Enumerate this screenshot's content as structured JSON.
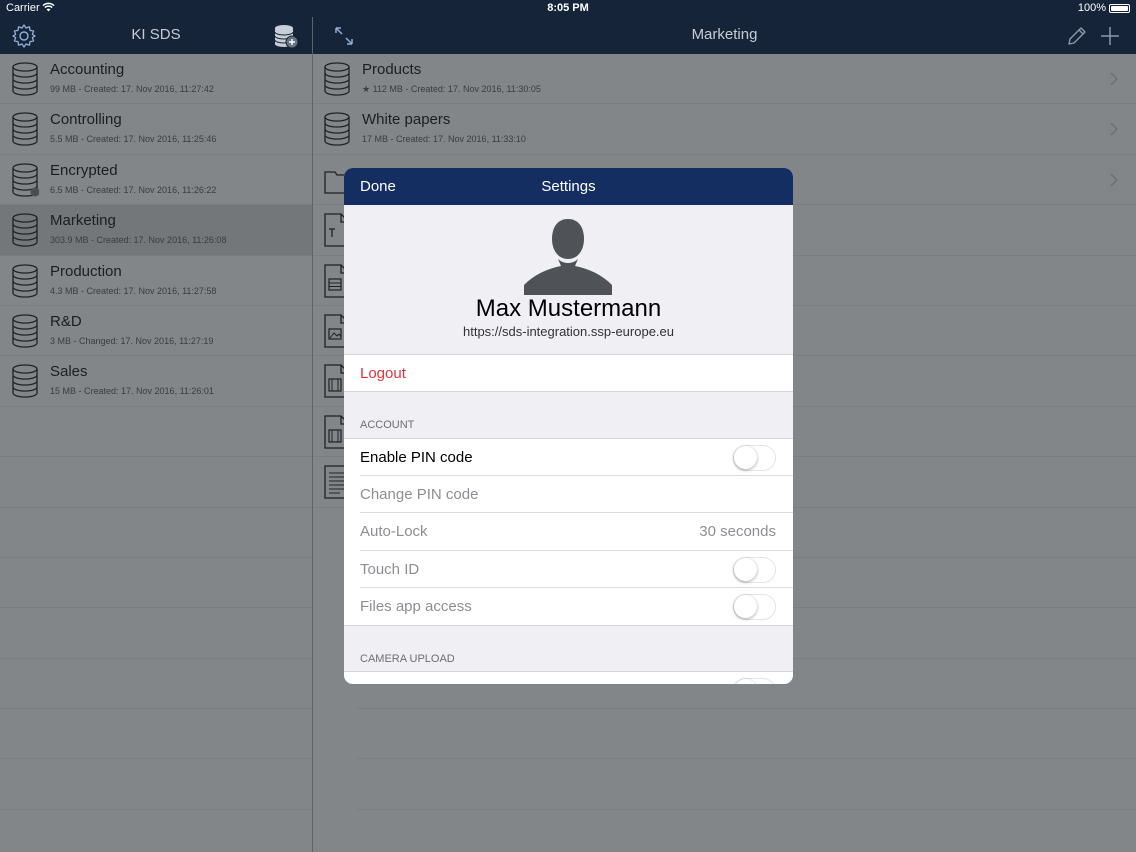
{
  "status_bar": {
    "carrier": "Carrier",
    "time": "8:05 PM",
    "battery": "100%"
  },
  "left_nav": {
    "title": "KI SDS",
    "settings_icon": "gear-icon",
    "add_room_icon": "database-add-icon"
  },
  "right_nav": {
    "title": "Marketing",
    "expand_icon": "expand-icon",
    "edit_icon": "pencil-icon",
    "add_icon": "plus-icon"
  },
  "sidebar": {
    "items": [
      {
        "title": "Accounting",
        "meta": "99 MB - Created: 17. Nov 2016, 11:27:42"
      },
      {
        "title": "Controlling",
        "meta": "5.5 MB - Created: 17. Nov 2016, 11:25:46"
      },
      {
        "title": "Encrypted",
        "meta": "6.5 MB - Created: 17. Nov 2016, 11:26:22"
      },
      {
        "title": "Marketing",
        "meta": "303.9 MB - Created: 17. Nov 2016, 11:26:08"
      },
      {
        "title": "Production",
        "meta": "4.3 MB - Created: 17. Nov 2016, 11:27:58"
      },
      {
        "title": "R&D",
        "meta": "3 MB - Changed: 17. Nov 2016, 11:27:19"
      },
      {
        "title": "Sales",
        "meta": "15 MB - Created: 17. Nov 2016, 11:26:01"
      }
    ]
  },
  "main_list": {
    "items": [
      {
        "title": "Products",
        "meta": "★ 112 MB - Created: 17. Nov 2016, 11:30:05"
      },
      {
        "title": "White papers",
        "meta": "17 MB - Created: 17. Nov 2016, 11:33:10"
      }
    ]
  },
  "settings": {
    "done_label": "Done",
    "title": "Settings",
    "user_name": "Max Mustermann",
    "server_url": "https://sds-integration.ssp-europe.eu",
    "logout_label": "Logout",
    "account_header": "ACCOUNT",
    "enable_pin_label": "Enable PIN code",
    "change_pin_label": "Change PIN code",
    "auto_lock_label": "Auto-Lock",
    "auto_lock_value": "30 seconds",
    "touch_id_label": "Touch ID",
    "files_app_label": "Files app access",
    "camera_upload_header": "CAMERA UPLOAD",
    "toggles": {
      "enable_pin": false,
      "touch_id": false,
      "files_app": false
    }
  },
  "colors": {
    "nav_bg": "#152439",
    "modal_header_bg": "#152e62",
    "destructive": "#e0343a"
  }
}
